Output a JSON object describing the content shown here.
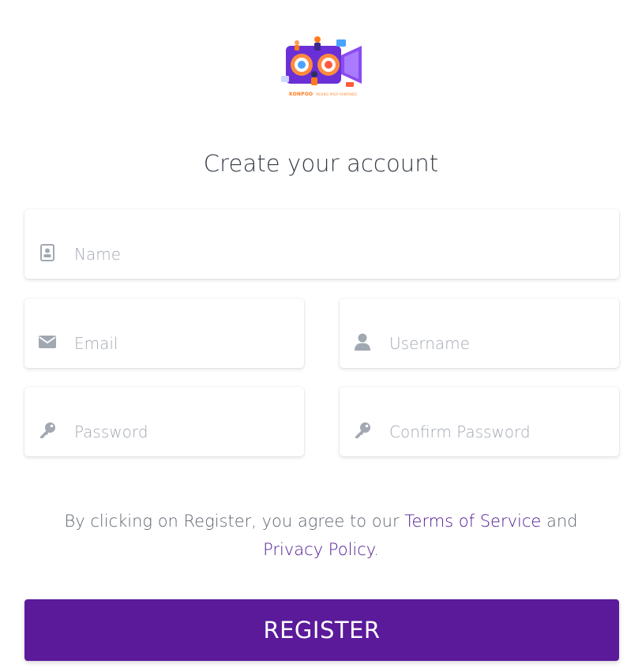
{
  "logo": {
    "brand": "KONPOO",
    "tagline": "MIXING PREP RAMONDS"
  },
  "title": "Create your account",
  "form": {
    "name_placeholder": "Name",
    "email_placeholder": "Email",
    "username_placeholder": "Username",
    "password_placeholder": "Password",
    "confirm_password_placeholder": "Confirm Password"
  },
  "terms": {
    "prefix": "By clicking on Register, you agree to our ",
    "terms_link": "Terms of Service",
    "middle": " and",
    "privacy_link": "Privacy Policy",
    "suffix": "."
  },
  "register_label": "REGISTER",
  "colors": {
    "accent": "#5b1a9a",
    "link": "#4e1890",
    "icon": "#a2a8b2",
    "title": "#333b44"
  },
  "icons": {
    "name": "id-card-icon",
    "email": "envelope-icon",
    "username": "user-icon",
    "password": "key-icon",
    "confirm_password": "key-icon"
  }
}
